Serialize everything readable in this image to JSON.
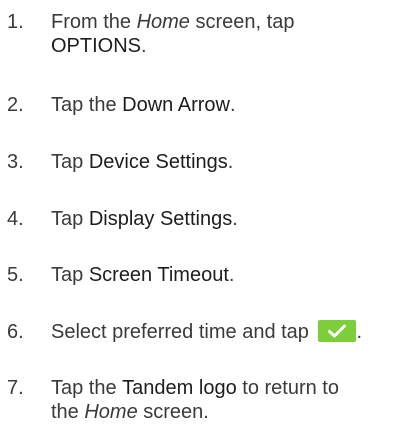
{
  "steps": [
    {
      "number": "1.",
      "parts": [
        {
          "t": "From the ",
          "s": "normal"
        },
        {
          "t": "Home",
          "s": "italic"
        },
        {
          "t": " screen, tap",
          "s": "normal"
        }
      ],
      "line2": [
        {
          "t": "OPTIONS",
          "s": "bold"
        },
        {
          "t": ".",
          "s": "normal"
        }
      ]
    },
    {
      "number": "2.",
      "parts": [
        {
          "t": "Tap the ",
          "s": "normal"
        },
        {
          "t": "Down Arrow",
          "s": "bold"
        },
        {
          "t": ".",
          "s": "normal"
        }
      ]
    },
    {
      "number": "3.",
      "parts": [
        {
          "t": "Tap ",
          "s": "normal"
        },
        {
          "t": "Device Settings",
          "s": "bold"
        },
        {
          "t": ".",
          "s": "normal"
        }
      ]
    },
    {
      "number": "4.",
      "parts": [
        {
          "t": "Tap ",
          "s": "normal"
        },
        {
          "t": "Display Settings",
          "s": "bold"
        },
        {
          "t": ".",
          "s": "normal"
        }
      ]
    },
    {
      "number": "5.",
      "parts": [
        {
          "t": "Tap ",
          "s": "normal"
        },
        {
          "t": "Screen Timeout",
          "s": "bold"
        },
        {
          "t": ".",
          "s": "normal"
        }
      ]
    },
    {
      "number": "6.",
      "parts": [
        {
          "t": "Select preferred time and tap ",
          "s": "normal"
        }
      ],
      "icon": "checkmark-button-icon",
      "after_icon": "."
    },
    {
      "number": "7.",
      "parts": [
        {
          "t": "Tap the ",
          "s": "normal"
        },
        {
          "t": "Tandem logo",
          "s": "bold"
        },
        {
          "t": " to return to",
          "s": "normal"
        }
      ],
      "line2": [
        {
          "t": "the ",
          "s": "normal"
        },
        {
          "t": "Home",
          "s": "italic"
        },
        {
          "t": " screen.",
          "s": "normal"
        }
      ]
    }
  ],
  "colors": {
    "text": "#3a3a3a",
    "bold_text": "#1d1d1d",
    "check_button": "#7ccf3a"
  }
}
